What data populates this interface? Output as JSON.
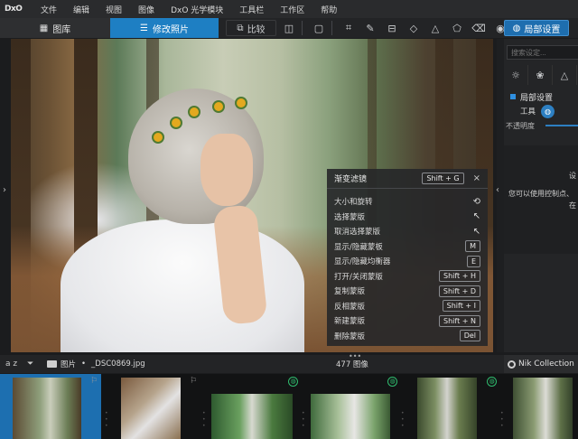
{
  "app": {
    "logo": "DxO"
  },
  "menu": [
    "文件",
    "编辑",
    "视图",
    "图像",
    "DxO 光学模块",
    "工具栏",
    "工作区",
    "帮助"
  ],
  "tabs": {
    "library": "图库",
    "edit": "修改照片"
  },
  "toolbar": {
    "compare": "比较",
    "local_adjust": "局部设置"
  },
  "shortcut_panel": {
    "title": "渐变滤镜",
    "title_key": "Shift + G",
    "close": "×",
    "rows": [
      {
        "label": "大小和旋转",
        "key": "",
        "glyph": "⟲"
      },
      {
        "label": "选择蒙版",
        "key": "",
        "glyph": "↖"
      },
      {
        "label": "取消选择蒙版",
        "key": "",
        "glyph": "↖"
      },
      {
        "label": "显示/隐藏蒙板",
        "key": "M",
        "glyph": ""
      },
      {
        "label": "显示/隐藏均衡器",
        "key": "E",
        "glyph": ""
      },
      {
        "label": "打开/关闭蒙版",
        "key": "Shift + H",
        "glyph": ""
      },
      {
        "label": "复制蒙版",
        "key": "Shift + D",
        "glyph": ""
      },
      {
        "label": "反相蒙版",
        "key": "Shift + I",
        "glyph": ""
      },
      {
        "label": "新建蒙版",
        "key": "Shift + N",
        "glyph": ""
      },
      {
        "label": "删除蒙版",
        "key": "Del",
        "glyph": ""
      }
    ]
  },
  "right_panel": {
    "search_placeholder": "搜索设定...",
    "section_title": "局部设置",
    "tools_label": "工具",
    "opacity_label": "不透明度",
    "hint_line1": "设",
    "hint_line2": "您可以使用控制点、",
    "hint_line3": "在"
  },
  "filmstrip_header": {
    "sort": "a z",
    "path_folder": "图片",
    "path_file": "_DSC0869.jpg",
    "count": "477 图像",
    "nik": "Nik Collection"
  },
  "colors": {
    "accent": "#1e7fc3",
    "badge_green": "#2fbb6e"
  }
}
